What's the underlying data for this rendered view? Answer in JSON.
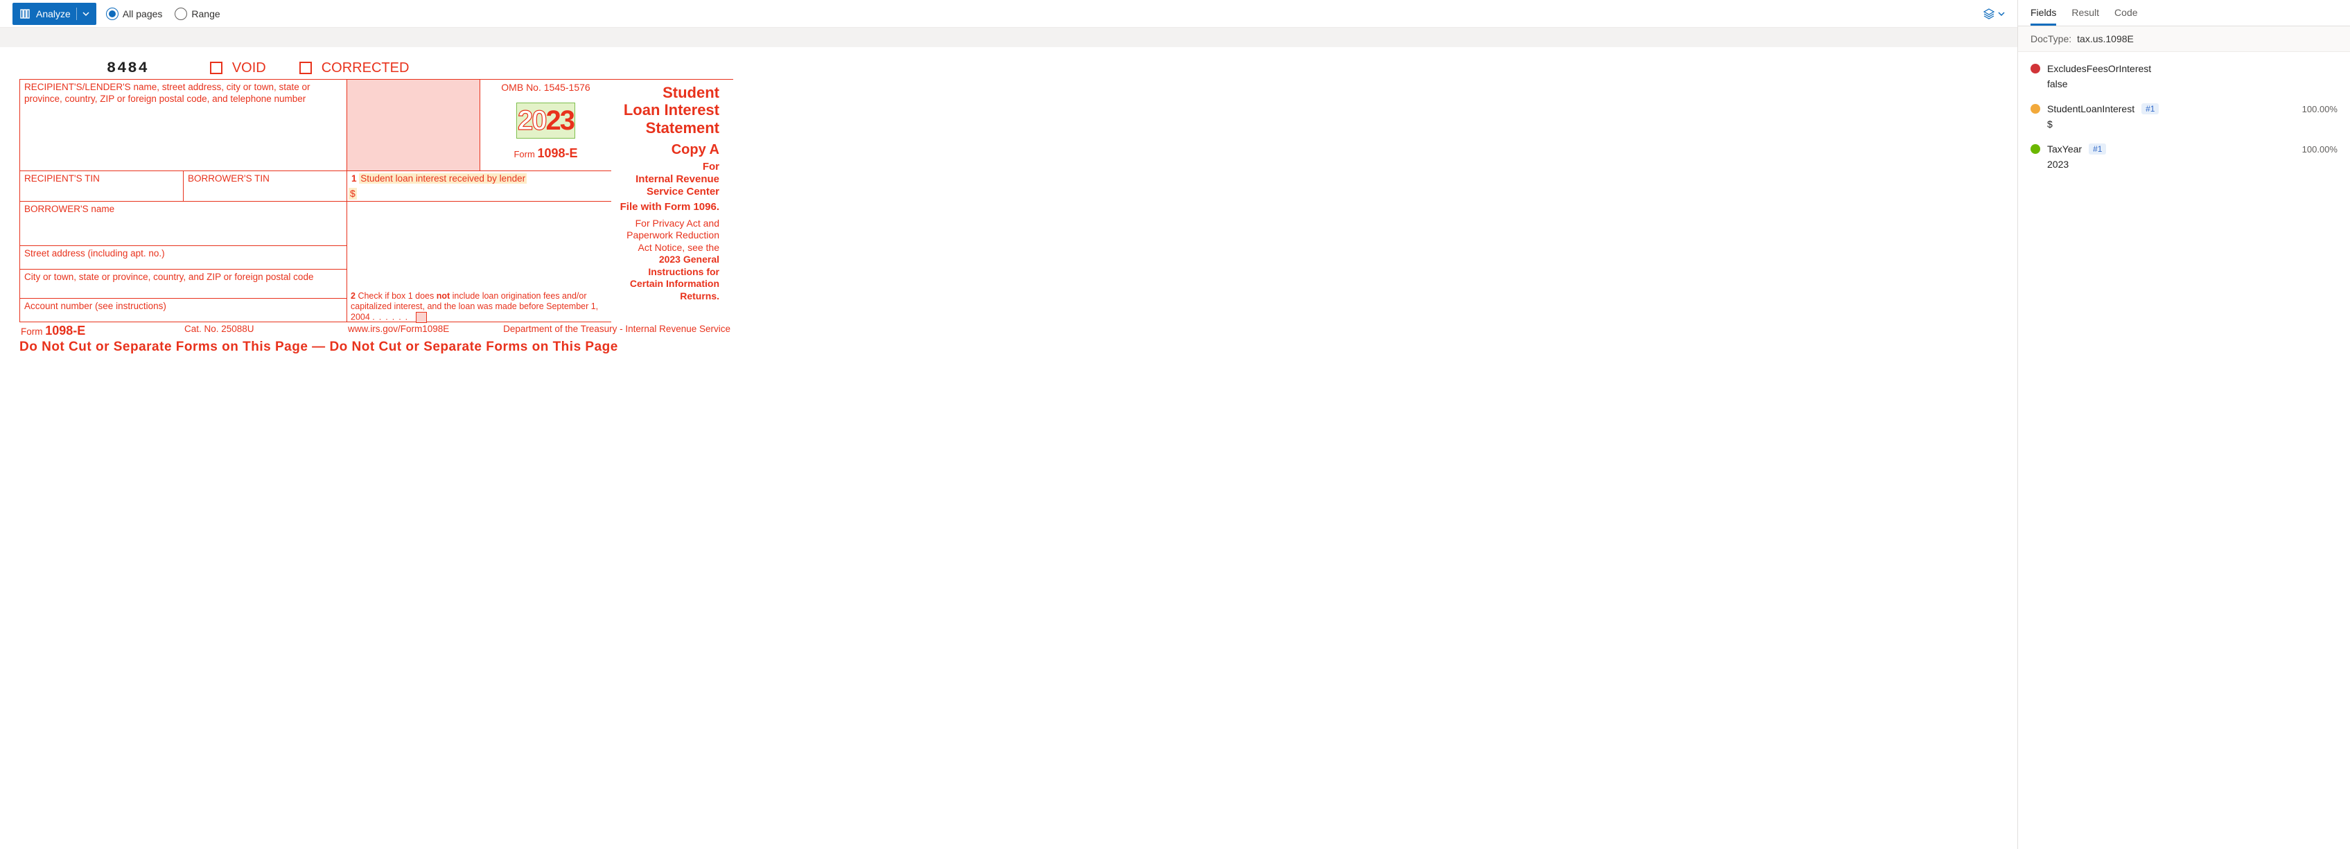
{
  "toolbar": {
    "analyze_label": "Analyze",
    "all_pages_label": "All pages",
    "range_label": "Range"
  },
  "form": {
    "barcode": "8484",
    "void_label": "VOID",
    "corrected_label": "CORRECTED",
    "recipient_lender_label": "RECIPIENT'S/LENDER'S name, street address, city or town, state or province, country, ZIP or foreign postal code, and telephone number",
    "omb": "OMB No. 1545-1576",
    "year_prefix": "20",
    "year_suffix": "23",
    "form_label_prefix": "Form",
    "form_number": "1098-E",
    "title_line1": "Student",
    "title_line2": "Loan Interest",
    "title_line3": "Statement",
    "copy_label": "Copy A",
    "for_line1": "For",
    "for_line2": "Internal Revenue",
    "for_line3": "Service Center",
    "file_with": "File with Form 1096.",
    "privacy": "For Privacy Act and Paperwork Reduction Act Notice, see the 2023 General Instructions for Certain Information Returns.",
    "recipient_tin_label": "RECIPIENT'S TIN",
    "borrower_tin_label": "BORROWER'S TIN",
    "box1_num": "1",
    "box1_label": "Student loan interest received by lender",
    "box1_value": "$",
    "borrower_name_label": "BORROWER'S name",
    "street_label": "Street address (including apt. no.)",
    "city_label": "City or town, state or province, country, and ZIP or foreign postal code",
    "account_label": "Account number (see instructions)",
    "box2_num": "2",
    "box2_text_a": "Check if box 1 does ",
    "box2_not": "not",
    "box2_text_b": " include loan origination fees and/or capitalized interest, and the loan was made before September 1, 2004",
    "footer_form_prefix": "Form",
    "footer_form_num": "1098-E",
    "cat_no": "Cat. No. 25088U",
    "url": "www.irs.gov/Form1098E",
    "dept": "Department of the Treasury - Internal Revenue Service",
    "warning": "Do Not Cut or Separate Forms on This Page — Do Not Cut or Separate Forms on This Page"
  },
  "panel": {
    "tabs": {
      "fields": "Fields",
      "result": "Result",
      "code": "Code"
    },
    "doctype_label": "DocType:",
    "doctype_value": "tax.us.1098E",
    "fields": [
      {
        "color": "red",
        "name": "ExcludesFeesOrInterest",
        "badge": "",
        "confidence": "",
        "value": "false"
      },
      {
        "color": "orange",
        "name": "StudentLoanInterest",
        "badge": "#1",
        "confidence": "100.00%",
        "value": "$"
      },
      {
        "color": "green",
        "name": "TaxYear",
        "badge": "#1",
        "confidence": "100.00%",
        "value": "2023"
      }
    ]
  }
}
